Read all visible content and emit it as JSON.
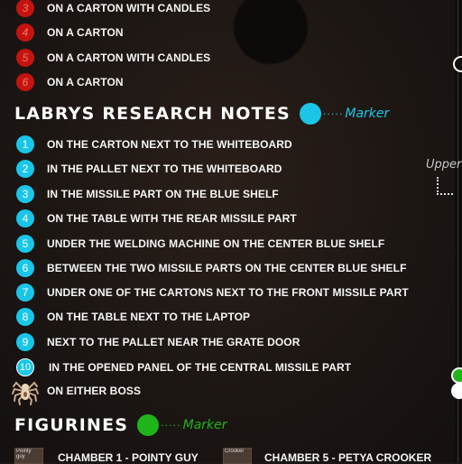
{
  "colors": {
    "red_marker": "#c4140f",
    "cyan_marker": "#19c6e8",
    "green_marker": "#1fb51a",
    "background": "#1c1714"
  },
  "top_list": [
    {
      "number": "3",
      "text": "ON A CARTON WITH CANDLES"
    },
    {
      "number": "4",
      "text": "ON A CARTON"
    },
    {
      "number": "5",
      "text": "ON A CARTON WITH CANDLES"
    },
    {
      "number": "6",
      "text": "ON A CARTON"
    }
  ],
  "research": {
    "title": "LABRYS RESEARCH NOTES",
    "marker_label": "Marker",
    "marker_color": "#19c6e8",
    "items": [
      {
        "number": "1",
        "text": "ON THE CARTON NEXT TO THE WHITEBOARD"
      },
      {
        "number": "2",
        "text": "IN THE PALLET NEXT TO THE WHITEBOARD"
      },
      {
        "number": "3",
        "text": "IN THE MISSILE PART ON THE BLUE SHELF"
      },
      {
        "number": "4",
        "text": "ON THE TABLE WITH THE REAR MISSILE PART"
      },
      {
        "number": "5",
        "text": "UNDER THE WELDING MACHINE ON THE CENTER BLUE SHELF"
      },
      {
        "number": "6",
        "text": "BETWEEN THE TWO MISSILE PARTS ON THE CENTER BLUE SHELF"
      },
      {
        "number": "7",
        "text": "UNDER ONE OF THE CARTONS NEXT TO THE FRONT MISSILE PART"
      },
      {
        "number": "8",
        "text": "ON THE TABLE NEXT TO THE LAPTOP"
      },
      {
        "number": "9",
        "text": "NEXT TO THE PALLET NEAR THE GRATE DOOR"
      },
      {
        "number": "10",
        "text": "IN THE OPENED PANEL OF THE CENTRAL MISSILE PART"
      }
    ],
    "boss_item": {
      "icon": "spider-icon",
      "text": "ON EITHER BOSS"
    }
  },
  "side_note": {
    "label": "Upper"
  },
  "figurines": {
    "title": "FIGURINES",
    "marker_label": "Marker",
    "marker_color": "#1fb51a",
    "items": [
      {
        "thumb_label": "Pointy guy",
        "text": "CHAMBER 1 - POINTY GUY"
      },
      {
        "thumb_label": "Crooker",
        "text": "CHAMBER 5 - PETYA CROOKER"
      }
    ]
  }
}
